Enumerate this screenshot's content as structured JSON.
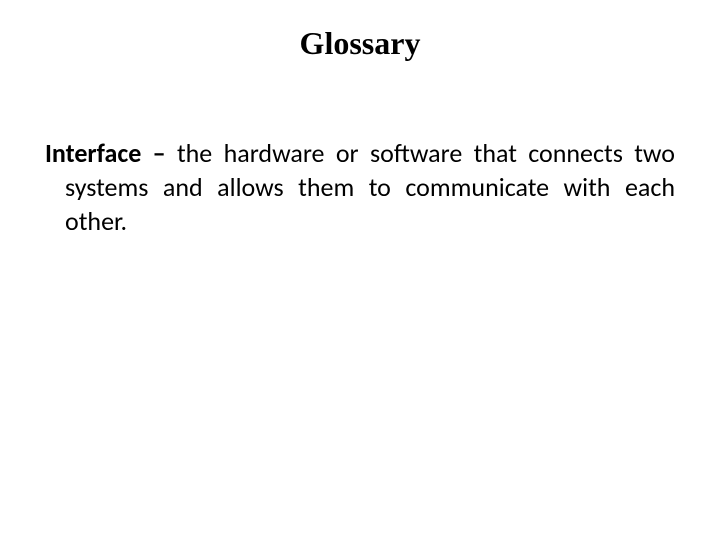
{
  "title": "Glossary",
  "entry": {
    "term": "Interface – ",
    "definition": "the hardware or software that connects two systems and allows them to communicate with each other."
  }
}
